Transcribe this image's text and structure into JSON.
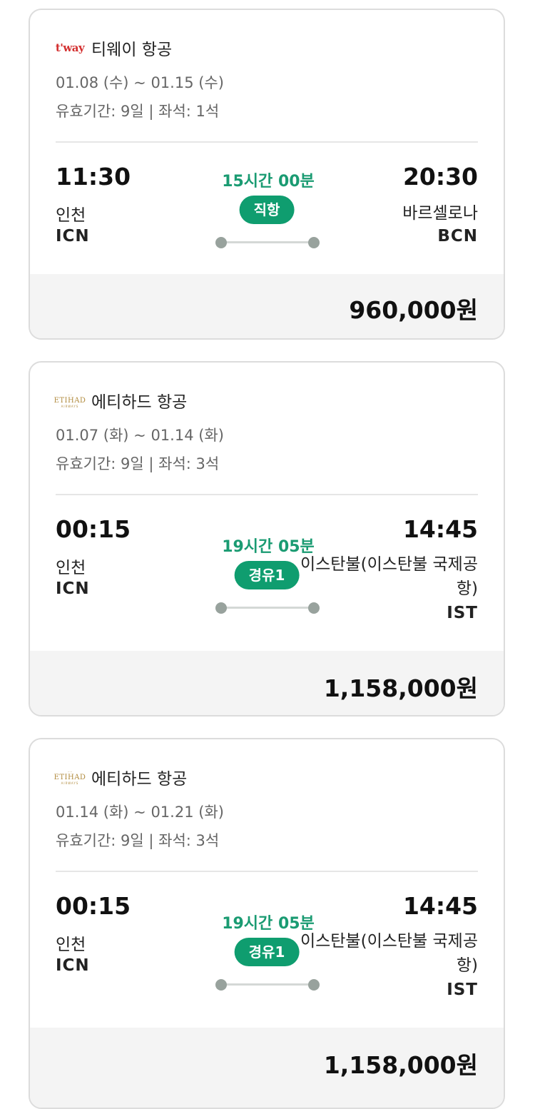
{
  "flights": [
    {
      "airline": "티웨이 항공",
      "logo_text": "t'way",
      "dates": "01.08 (수) ~ 01.15 (수)",
      "validity": "유효기간: 9일 | 좌석: 1석",
      "dep_time": "11:30",
      "dep_city": "인천",
      "dep_code": "ICN",
      "duration": "15시간 00분",
      "stops": "직항",
      "arr_time": "20:30",
      "arr_city": "바르셀로나",
      "arr_code": "BCN",
      "price": "960,000원"
    },
    {
      "airline": "에티하드 항공",
      "logo_text": "ETIHAD",
      "logo_sub": "AIRWAYS",
      "dates": "01.07 (화) ~ 01.14 (화)",
      "validity": "유효기간: 9일 | 좌석: 3석",
      "dep_time": "00:15",
      "dep_city": "인천",
      "dep_code": "ICN",
      "duration": "19시간 05분",
      "stops": "경유1",
      "arr_time": "14:45",
      "arr_city": "이스탄불(이스탄불 국제공항)",
      "arr_code": "IST",
      "price": "1,158,000원"
    },
    {
      "airline": "에티하드 항공",
      "logo_text": "ETIHAD",
      "logo_sub": "AIRWAYS",
      "dates": "01.14 (화) ~ 01.21 (화)",
      "validity": "유효기간: 9일 | 좌석: 3석",
      "dep_time": "00:15",
      "dep_city": "인천",
      "dep_code": "ICN",
      "duration": "19시간 05분",
      "stops": "경유1",
      "arr_time": "14:45",
      "arr_city": "이스탄불(이스탄불 국제공항)",
      "arr_code": "IST",
      "price": "1,158,000원"
    }
  ],
  "colors": {
    "accent_green": "#0f9d6f",
    "duration_green": "#1a9b72",
    "tway_red": "#d32f2f",
    "etihad_gold": "#b08a3c",
    "price_bg": "#f4f4f4"
  }
}
